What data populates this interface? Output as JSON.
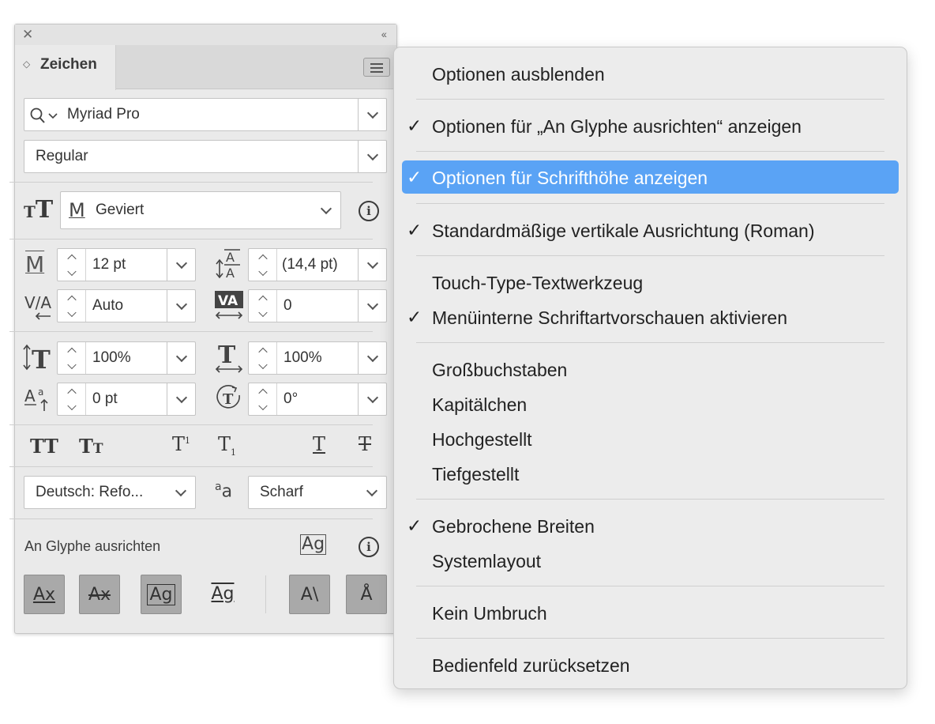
{
  "panel": {
    "title": "Zeichen",
    "font_family": "Myriad Pro",
    "font_style": "Regular",
    "unit_select": "Geviert",
    "size": "12 pt",
    "leading": "(14,4 pt)",
    "kerning": "Auto",
    "tracking": "0",
    "vscale": "100%",
    "hscale": "100%",
    "baseline": "0 pt",
    "rotation": "0°",
    "language": "Deutsch: Refo...",
    "antialias": "Scharf",
    "glyph_section": "An Glyphe ausrichten",
    "icons": {
      "font_size_icon": "M",
      "vscale_icon": "T",
      "hscale_icon": "T"
    }
  },
  "menu": {
    "items": [
      {
        "label": "Optionen ausblenden",
        "check": ""
      },
      {
        "label": "Optionen für „An Glyphe ausrichten“ anzeigen",
        "check": "✓"
      },
      {
        "label": "Optionen für Schrifthöhe anzeigen",
        "check": "✓"
      },
      {
        "label": "Standardmäßige vertikale Ausrichtung (Roman)",
        "check": "✓"
      },
      {
        "label": "Touch-Type-Textwerkzeug",
        "check": ""
      },
      {
        "label": "Menüinterne Schriftartvorschauen aktivieren",
        "check": "✓"
      },
      {
        "label": "Großbuchstaben",
        "check": ""
      },
      {
        "label": "Kapitälchen",
        "check": ""
      },
      {
        "label": "Hochgestellt",
        "check": ""
      },
      {
        "label": "Tiefgestellt",
        "check": ""
      },
      {
        "label": "Gebrochene Breiten",
        "check": "✓"
      },
      {
        "label": "Systemlayout",
        "check": ""
      },
      {
        "label": "Kein Umbruch",
        "check": ""
      },
      {
        "label": "Bedienfeld zurücksetzen",
        "check": ""
      }
    ],
    "highlight_color": "#5aa3f5"
  }
}
